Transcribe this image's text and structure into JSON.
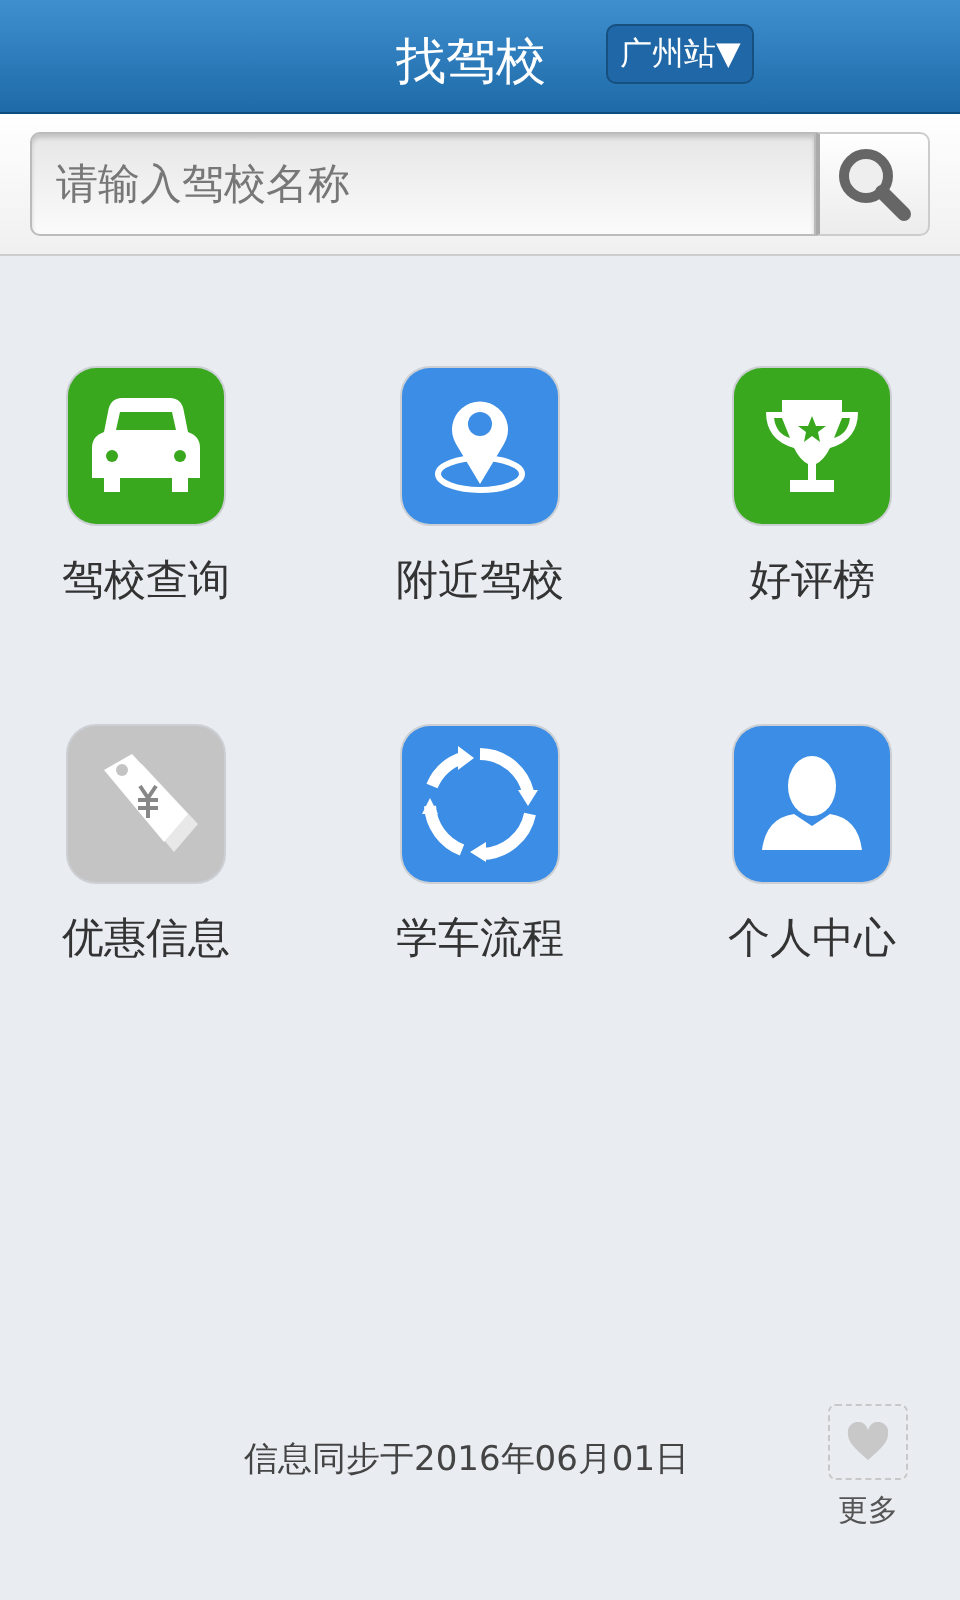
{
  "header": {
    "title": "找驾校",
    "city": "广州站",
    "city_arrow": "▼"
  },
  "search": {
    "placeholder": "请输入驾校名称"
  },
  "tiles": [
    {
      "kind": "car",
      "label": "驾校查询",
      "color": "#3aa81e"
    },
    {
      "kind": "pin",
      "label": "附近驾校",
      "color": "#3b8de6"
    },
    {
      "kind": "trophy",
      "label": "好评榜",
      "color": "#3aa81e"
    },
    {
      "kind": "tag",
      "label": "优惠信息",
      "color": "#c4c4c4"
    },
    {
      "kind": "cycle",
      "label": "学车流程",
      "color": "#3b8de6"
    },
    {
      "kind": "person",
      "label": "个人中心",
      "color": "#3b8de6"
    }
  ],
  "footer": {
    "sync_text": "信息同步于2016年06月01日",
    "more_label": "更多"
  }
}
